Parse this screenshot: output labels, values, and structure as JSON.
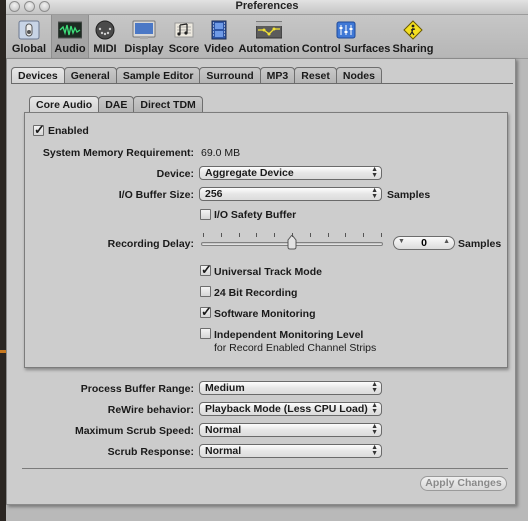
{
  "window": {
    "title": "Preferences"
  },
  "toolbar": {
    "items": [
      {
        "label": "Global",
        "icon": "global-switch-icon"
      },
      {
        "label": "Audio",
        "icon": "audio-waveform-icon",
        "selected": true
      },
      {
        "label": "MIDI",
        "icon": "midi-connector-icon"
      },
      {
        "label": "Display",
        "icon": "display-monitor-icon"
      },
      {
        "label": "Score",
        "icon": "score-notes-icon"
      },
      {
        "label": "Video",
        "icon": "video-film-icon"
      },
      {
        "label": "Automation",
        "icon": "automation-curve-icon"
      },
      {
        "label": "Control Surfaces",
        "icon": "control-surfaces-faders-icon"
      },
      {
        "label": "Sharing",
        "icon": "sharing-sign-icon"
      }
    ]
  },
  "tabs": {
    "items": [
      "Devices",
      "General",
      "Sample Editor",
      "Surround",
      "MP3",
      "Reset",
      "Nodes"
    ],
    "active": "Devices"
  },
  "subtabs": {
    "items": [
      "Core Audio",
      "DAE",
      "Direct TDM"
    ],
    "active": "Core Audio"
  },
  "core_audio": {
    "enabled": {
      "label": "Enabled",
      "checked": true
    },
    "memory": {
      "label": "System Memory Requirement:",
      "value": "69.0 MB"
    },
    "device": {
      "label": "Device:",
      "value": "Aggregate Device"
    },
    "buffer": {
      "label": "I/O Buffer Size:",
      "value": "256",
      "unit": "Samples"
    },
    "safety_buffer": {
      "label": "I/O Safety Buffer",
      "checked": false
    },
    "recording_delay": {
      "label": "Recording Delay:",
      "value": "0",
      "unit": "Samples",
      "slider_fraction": 0.5
    },
    "universal_track": {
      "label": "Universal Track Mode",
      "checked": true
    },
    "bit24": {
      "label": "24 Bit Recording",
      "checked": false
    },
    "software_monitoring": {
      "label": "Software Monitoring",
      "checked": true
    },
    "independent_monitoring": {
      "label": "Independent Monitoring Level",
      "sublabel": "for Record Enabled Channel Strips",
      "checked": false
    }
  },
  "general": {
    "process_buffer": {
      "label": "Process Buffer Range:",
      "value": "Medium"
    },
    "rewire": {
      "label": "ReWire behavior:",
      "value": "Playback Mode (Less CPU Load)"
    },
    "scrub_speed": {
      "label": "Maximum Scrub Speed:",
      "value": "Normal"
    },
    "scrub_response": {
      "label": "Scrub Response:",
      "value": "Normal"
    }
  },
  "buttons": {
    "apply": "Apply Changes"
  }
}
